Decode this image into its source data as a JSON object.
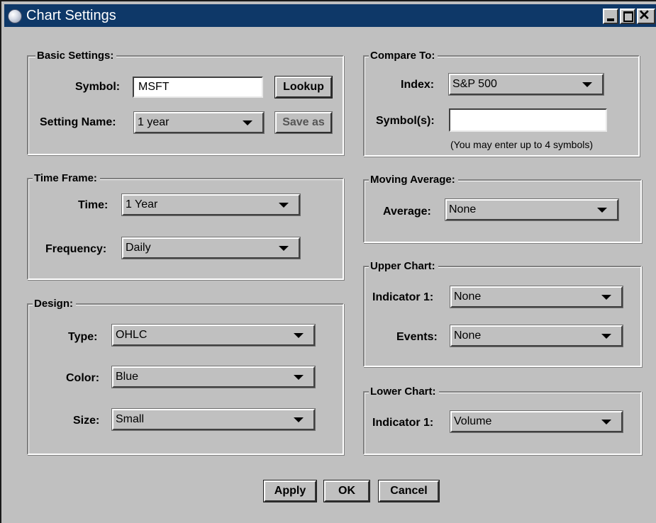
{
  "window": {
    "title": "Chart Settings",
    "controls": {
      "minimize": "minimize-icon",
      "maximize": "maximize-icon",
      "close": "close-icon"
    }
  },
  "basic_settings": {
    "title": "Basic Settings:",
    "symbol_label": "Symbol:",
    "symbol_value": "MSFT",
    "lookup_label": "Lookup",
    "setting_name_label": "Setting Name:",
    "setting_name_value": "1 year",
    "save_as_label": "Save as"
  },
  "compare_to": {
    "title": "Compare To:",
    "index_label": "Index:",
    "index_value": "S&P 500",
    "symbols_label": "Symbol(s):",
    "symbols_value": "",
    "hint": "(You may enter up to 4 symbols)"
  },
  "time_frame": {
    "title": "Time Frame:",
    "time_label": "Time:",
    "time_value": "1 Year",
    "frequency_label": "Frequency:",
    "frequency_value": "Daily"
  },
  "moving_average": {
    "title": "Moving Average:",
    "average_label": "Average:",
    "average_value": "None"
  },
  "upper_chart": {
    "title": "Upper Chart:",
    "indicator_label": "Indicator 1:",
    "indicator_value": "None",
    "events_label": "Events:",
    "events_value": "None"
  },
  "design": {
    "title": "Design:",
    "type_label": "Type:",
    "type_value": "OHLC",
    "color_label": "Color:",
    "color_value": "Blue",
    "size_label": "Size:",
    "size_value": "Small"
  },
  "lower_chart": {
    "title": "Lower Chart:",
    "indicator_label": "Indicator 1:",
    "indicator_value": "Volume"
  },
  "footer": {
    "apply_label": "Apply",
    "ok_label": "OK",
    "cancel_label": "Cancel"
  },
  "colors": {
    "titlebar": "#0e3868",
    "window_bg": "#c0c0c0",
    "field_bg": "#ffffff"
  }
}
